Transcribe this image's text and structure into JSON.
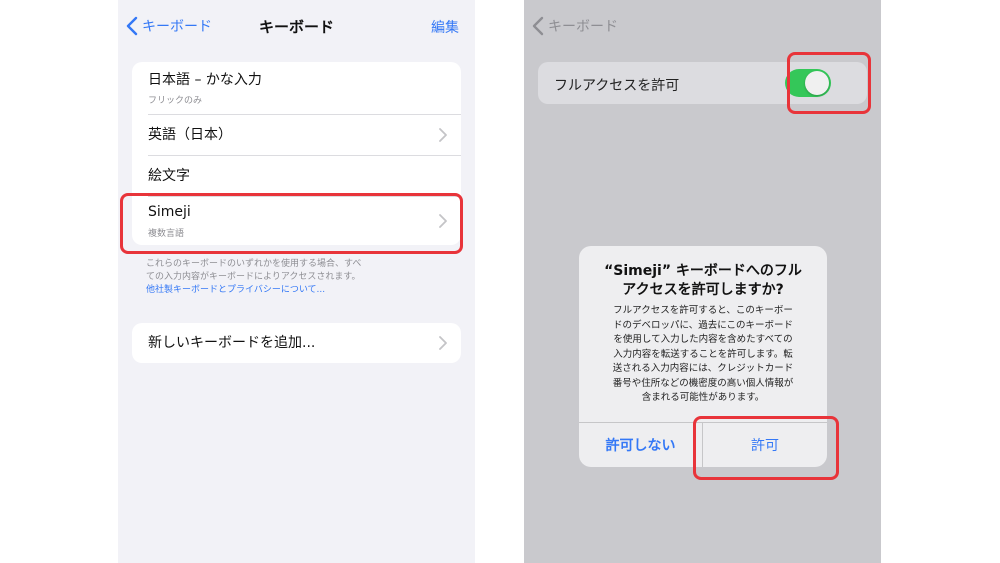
{
  "left": {
    "nav": {
      "back_label": "キーボード",
      "title": "キーボード",
      "edit_label": "編集"
    },
    "keyboards": [
      {
        "title": "日本語 – かな入力",
        "subtitle": "フリックのみ"
      },
      {
        "title": "英語（日本）",
        "subtitle": ""
      },
      {
        "title": "絵文字",
        "subtitle": ""
      },
      {
        "title": "Simeji",
        "subtitle": "複数言語"
      }
    ],
    "footnote": {
      "line1": "これらのキーボードのいずれかを使用する場合、すべ",
      "line2": "ての入力内容がキーボードによりアクセスされます。",
      "link": "他社製キーボードとプライバシーについて..."
    },
    "add_keyboard": "新しいキーボードを追加..."
  },
  "right": {
    "nav": {
      "back_label": "キーボード"
    },
    "full_access_label": "フルアクセスを許可",
    "full_access_on": true,
    "alert": {
      "title_line1": "“Simeji” キーボードへのフル",
      "title_line2": "アクセスを許可しますか?",
      "message_lines": [
        "フルアクセスを許可すると、このキーボー",
        "ドのデベロッパに、過去にこのキーボード",
        "を使用して入力した内容を含めたすべての",
        "入力内容を転送することを許可します。転",
        "送される入力内容には、クレジットカード",
        "番号や住所などの機密度の高い個人情報が",
        "含まれる可能性があります。"
      ],
      "deny_label": "許可しない",
      "allow_label": "許可"
    }
  },
  "colors": {
    "accent": "#3478f6",
    "toggle_on": "#34c759",
    "highlight": "#e8343a"
  }
}
